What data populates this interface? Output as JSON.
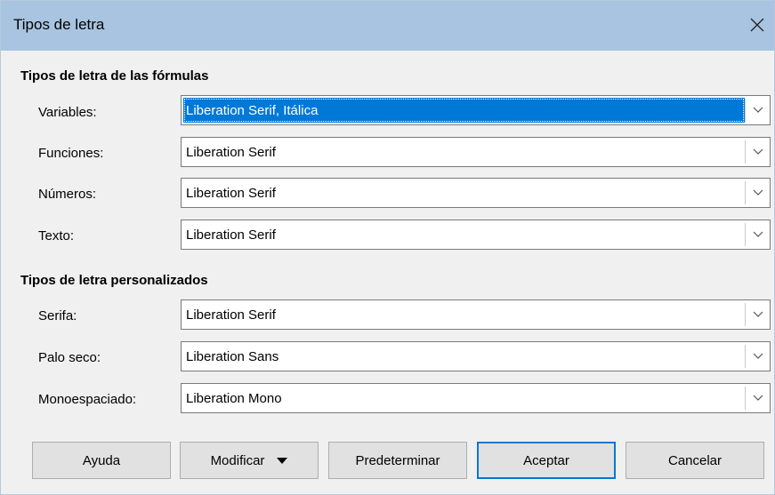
{
  "window": {
    "title": "Tipos de letra"
  },
  "formula_fonts": {
    "heading": "Tipos de letra de las fórmulas",
    "rows": [
      {
        "label": "Variables:",
        "value": "Liberation Serif, Itálica"
      },
      {
        "label": "Funciones:",
        "value": "Liberation Serif"
      },
      {
        "label": "Números:",
        "value": "Liberation Serif"
      },
      {
        "label": "Texto:",
        "value": "Liberation Serif"
      }
    ]
  },
  "custom_fonts": {
    "heading": "Tipos de letra personalizados",
    "rows": [
      {
        "label": "Serifa:",
        "value": "Liberation Serif"
      },
      {
        "label": "Palo seco:",
        "value": "Liberation Sans"
      },
      {
        "label": "Monoespaciado:",
        "value": "Liberation Mono"
      }
    ]
  },
  "buttons": {
    "help": "Ayuda",
    "modify": "Modificar",
    "default": "Predeterminar",
    "ok": "Aceptar",
    "cancel": "Cancelar"
  },
  "icons": {
    "close": "close-icon",
    "dropdown": "chevron-down-icon",
    "menu_arrow": "triangle-down-icon"
  },
  "colors": {
    "titlebar": "#a8c4e0",
    "selection": "#0078d7",
    "default_button_border": "#0078d7"
  }
}
